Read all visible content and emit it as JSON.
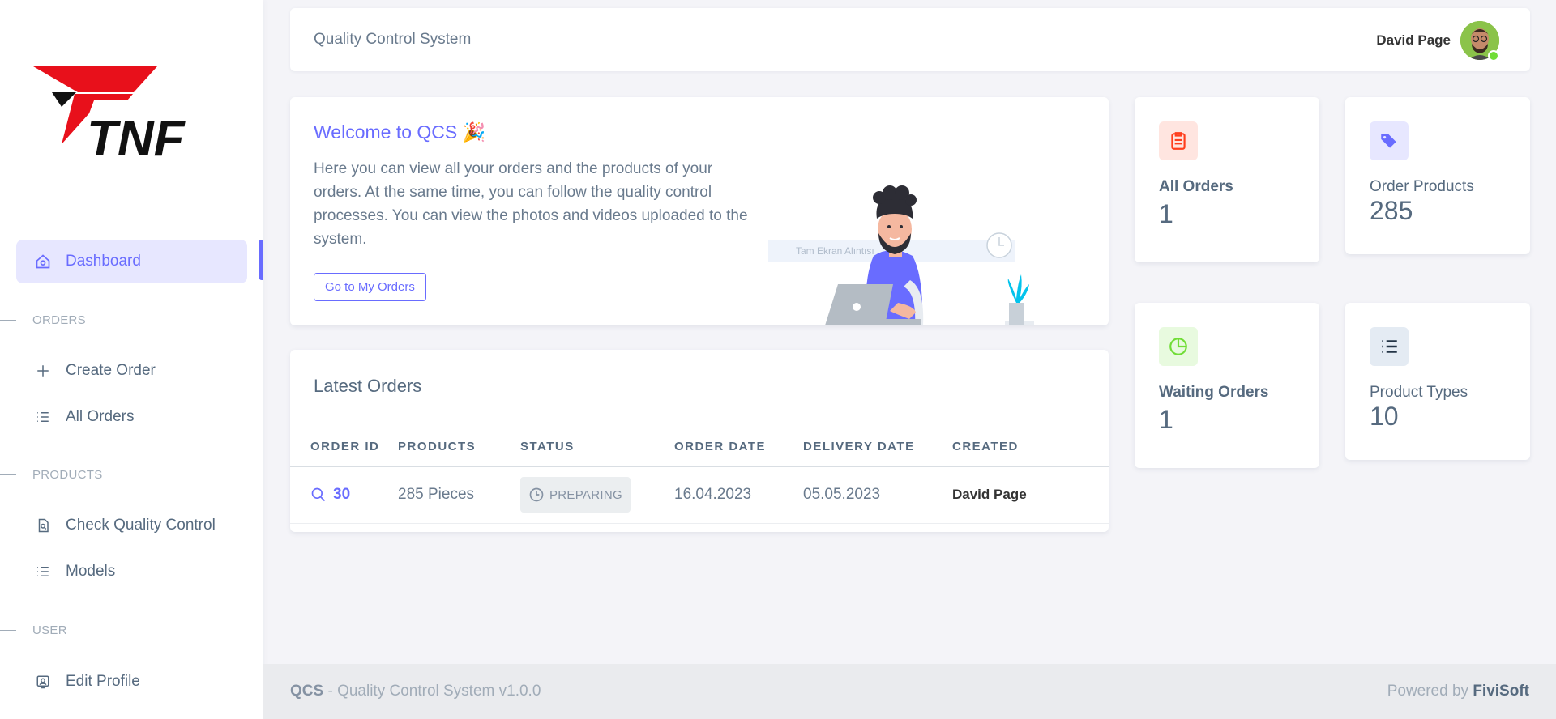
{
  "brand": {
    "logo_text": "TNF"
  },
  "sidebar": {
    "dashboard": "Dashboard",
    "headers": {
      "orders": "ORDERS",
      "products": "PRODUCTS",
      "user": "USER"
    },
    "create_order": "Create Order",
    "all_orders": "All Orders",
    "check_quality": "Check Quality Control",
    "models": "Models",
    "edit_profile": "Edit Profile"
  },
  "navbar": {
    "title": "Quality Control System",
    "user_name": "David Page"
  },
  "welcome": {
    "title": "Welcome to QCS 🎉",
    "text": "Here you can view all your orders and the products of your orders. At the same time, you can follow the quality control processes. You can view the photos and videos uploaded to the system.",
    "button": "Go to My Orders",
    "screen_label": "Tam Ekran Alıntısı"
  },
  "orders": {
    "title": "Latest Orders",
    "columns": [
      "ORDER ID",
      "PRODUCTS",
      "STATUS",
      "ORDER DATE",
      "DELIVERY DATE",
      "CREATED"
    ],
    "rows": [
      {
        "id": "30",
        "products": "285 Pieces",
        "status": "PREPARING",
        "order_date": "16.04.2023",
        "delivery_date": "05.05.2023",
        "created": "David Page"
      }
    ]
  },
  "stats": {
    "all_orders": {
      "label": "All Orders",
      "value": "1"
    },
    "order_products": {
      "label": "Order Products",
      "value": "285"
    },
    "waiting_orders": {
      "label": "Waiting Orders",
      "value": "1"
    },
    "product_types": {
      "label": "Product Types",
      "value": "10"
    }
  },
  "footer": {
    "brand": "QCS",
    "version_text": " - Quality Control System v1.0.0",
    "powered_by": "Powered by ",
    "company": "FiviSoft"
  },
  "colors": {
    "primary": "#696cff",
    "logo_red": "#e8101b",
    "success": "#71dd37",
    "warning": "#ff3e1d",
    "info": "#03c3ec",
    "secondary": "#8592a3"
  }
}
